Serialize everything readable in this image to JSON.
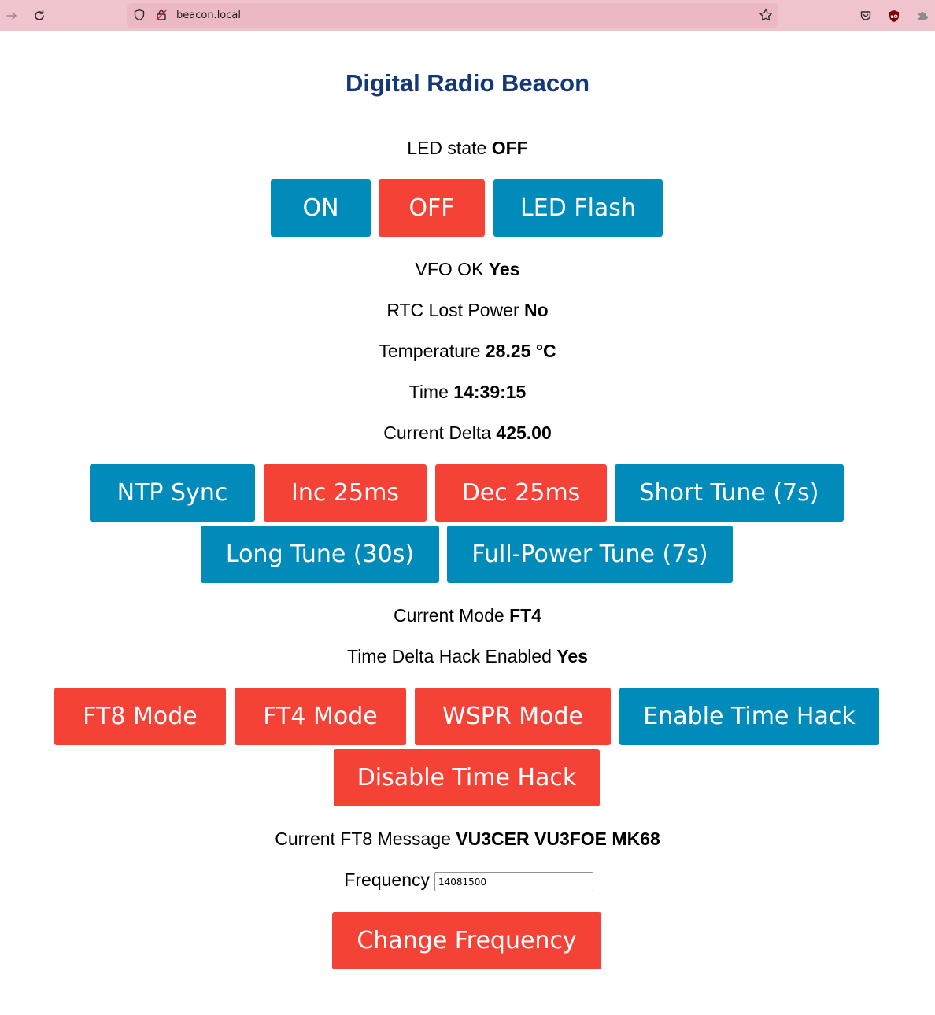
{
  "browser": {
    "url": "beacon.local"
  },
  "page": {
    "title": "Digital Radio Beacon",
    "led_state": {
      "label": "LED state",
      "value": "OFF"
    },
    "led_buttons": {
      "on": "ON",
      "off": "OFF",
      "flash": "LED Flash"
    },
    "vfo_ok": {
      "label": "VFO OK",
      "value": "Yes"
    },
    "rtc_lost_power": {
      "label": "RTC Lost Power",
      "value": "No"
    },
    "temperature": {
      "label": "Temperature",
      "value": "28.25 °C"
    },
    "time": {
      "label": "Time",
      "value": "14:39:15"
    },
    "current_delta": {
      "label": "Current Delta",
      "value": "425.00"
    },
    "timing_buttons": {
      "ntp_sync": "NTP Sync",
      "inc_25ms": "Inc 25ms",
      "dec_25ms": "Dec 25ms",
      "short_tune": "Short Tune (7s)",
      "long_tune": "Long Tune (30s)",
      "full_power_tune": "Full-Power Tune (7s)"
    },
    "current_mode": {
      "label": "Current Mode",
      "value": "FT4"
    },
    "time_delta_hack": {
      "label": "Time Delta Hack Enabled",
      "value": "Yes"
    },
    "mode_buttons": {
      "ft8": "FT8 Mode",
      "ft4": "FT4 Mode",
      "wspr": "WSPR Mode",
      "enable_hack": "Enable Time Hack",
      "disable_hack": "Disable Time Hack"
    },
    "ft8_message": {
      "label": "Current FT8 Message",
      "value": "VU3CER VU3FOE MK68"
    },
    "frequency": {
      "label": "Frequency",
      "value": "14081500"
    },
    "change_frequency_button": "Change Frequency"
  },
  "colors": {
    "title": "#143877",
    "button_blue": "#008bbb",
    "button_red": "#f44336",
    "toolbar_bg": "#f0c4cc"
  }
}
